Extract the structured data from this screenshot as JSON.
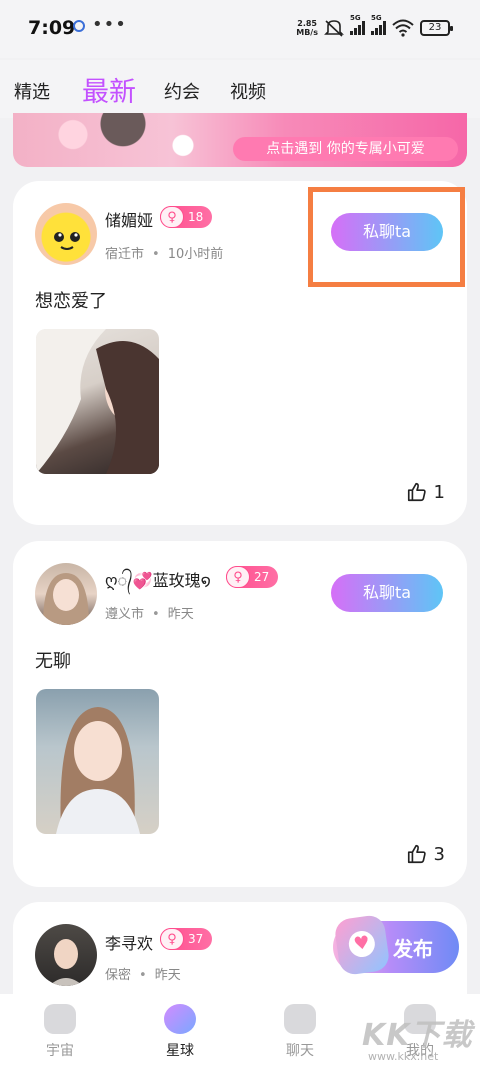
{
  "status_bar": {
    "time": "7:09",
    "dots": "•••",
    "net_speed_value": "2.85",
    "net_speed_unit": "MB/s",
    "sig1_label": "5G",
    "sig2_label": "5G",
    "battery": "23"
  },
  "tabs": [
    {
      "label": "精选",
      "active": false
    },
    {
      "label": "最新",
      "active": true
    },
    {
      "label": "约会",
      "active": false
    },
    {
      "label": "视频",
      "active": false
    }
  ],
  "banner": {
    "headline": "点击遇到",
    "subtitle": "点击遇到 你的专属小可爱"
  },
  "posts": [
    {
      "name": "储媚娅",
      "gender_symbol": "♀",
      "age": "18",
      "city": "宿迁市",
      "time": "10小时前",
      "chat_label": "私聊ta",
      "text": "想恋爱了",
      "likes": "1"
    },
    {
      "name": "ღ᭄💞蓝玫瑰໑",
      "gender_symbol": "♀",
      "age": "27",
      "city": "遵义市",
      "time": "昨天",
      "chat_label": "私聊ta",
      "text": "无聊",
      "likes": "3"
    },
    {
      "name": "李寻欢",
      "gender_symbol": "♀",
      "age": "37",
      "city": "保密",
      "time": "昨天"
    }
  ],
  "publish": {
    "label": "发布"
  },
  "bottom_nav": [
    {
      "label": "宇宙",
      "icon": "universe-icon"
    },
    {
      "label": "星球",
      "icon": "planet-icon"
    },
    {
      "label": "聊天",
      "icon": "chat-icon"
    },
    {
      "label": "我的",
      "icon": "profile-icon"
    }
  ],
  "watermark": {
    "logo": "KK下载",
    "url": "www.kkx.net"
  },
  "colors": {
    "accent": "#c351ff",
    "badge": "#ff4d8d",
    "highlight": "#f57e42"
  }
}
